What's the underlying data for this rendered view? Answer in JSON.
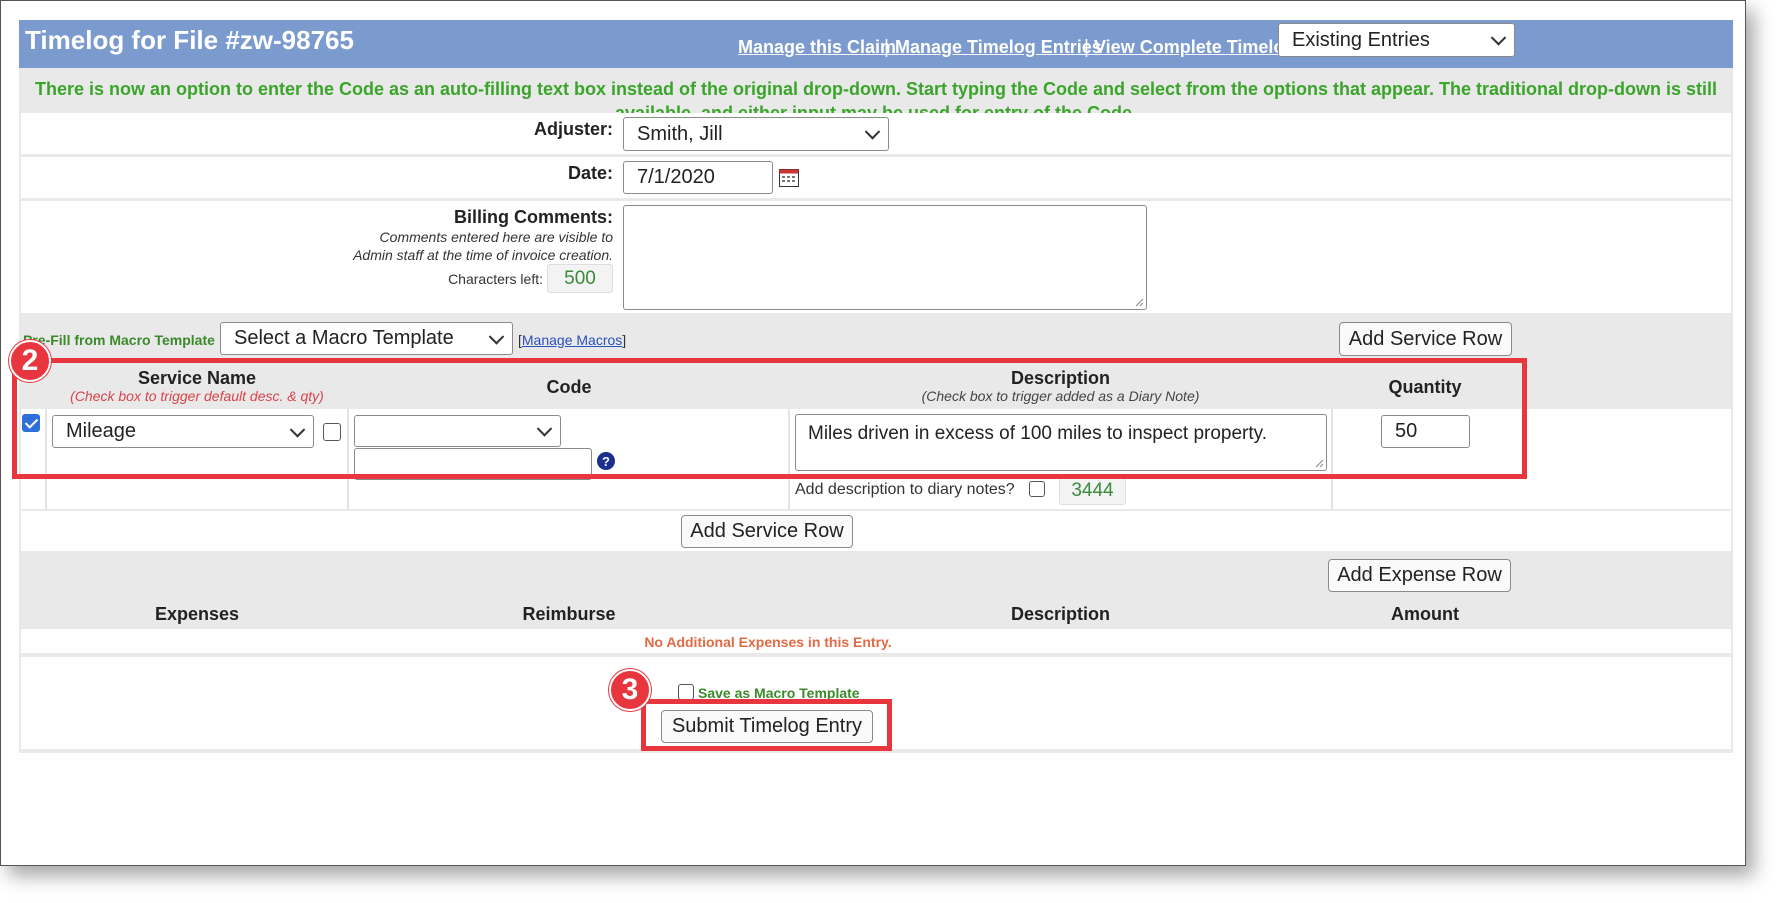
{
  "header": {
    "title": "Timelog for File #zw-98765",
    "links": [
      "Manage this Claim",
      "Manage Timelog Entries",
      "View Complete Timelog"
    ],
    "separator": "|",
    "entries_select": "Existing Entries"
  },
  "notice": {
    "text": "There is now an option to enter the Code as an auto-filling text box instead of the original drop-down. Start typing the Code and select from the options that appear. The traditional drop-down is still available, and either input may be used for entry of the Code."
  },
  "form": {
    "adjuster_label": "Adjuster:",
    "adjuster_value": "Smith, Jill",
    "date_label": "Date:",
    "date_value": "7/1/2020",
    "billing_label": "Billing Comments:",
    "billing_note_1": "Comments entered here are visible to",
    "billing_note_2": "Admin staff at the time of invoice creation.",
    "chars_left_label": "Characters left:",
    "chars_left_value": "500"
  },
  "macro": {
    "label": "Pre-Fill from Macro Template",
    "select": "Select a Macro Template",
    "manage_prefix": "[",
    "manage_link": "Manage Macros",
    "manage_suffix": "]",
    "add_service_row": "Add Service Row"
  },
  "services": {
    "headers": {
      "service_name": "Service Name",
      "service_note": "(Check box to trigger default desc. & qty)",
      "code": "Code",
      "description": "Description",
      "description_note": "(Check box to trigger added as a Diary Note)",
      "quantity": "Quantity"
    },
    "row": {
      "service": "Mileage",
      "code": "",
      "code_text": "",
      "description": "Miles driven in excess of 100 miles to inspect property.",
      "quantity": "50",
      "diary_label": "Add description to diary notes?",
      "chars_left": "3444"
    },
    "add_service_row": "Add Service Row"
  },
  "expenses": {
    "add_expense_row": "Add Expense Row",
    "headers": [
      "Expenses",
      "Reimburse",
      "Description",
      "Amount"
    ],
    "empty": "No Additional Expenses in this Entry."
  },
  "footer": {
    "save_macro": "Save as Macro Template",
    "submit": "Submit Timelog Entry"
  },
  "annotations": {
    "badge_services": "2",
    "badge_submit": "3"
  },
  "colors": {
    "header_bg": "#7b9bcf",
    "notice_green": "#3aa52a",
    "annotation_red": "#e8363f",
    "checkbox_blue": "#2f6fdb"
  }
}
